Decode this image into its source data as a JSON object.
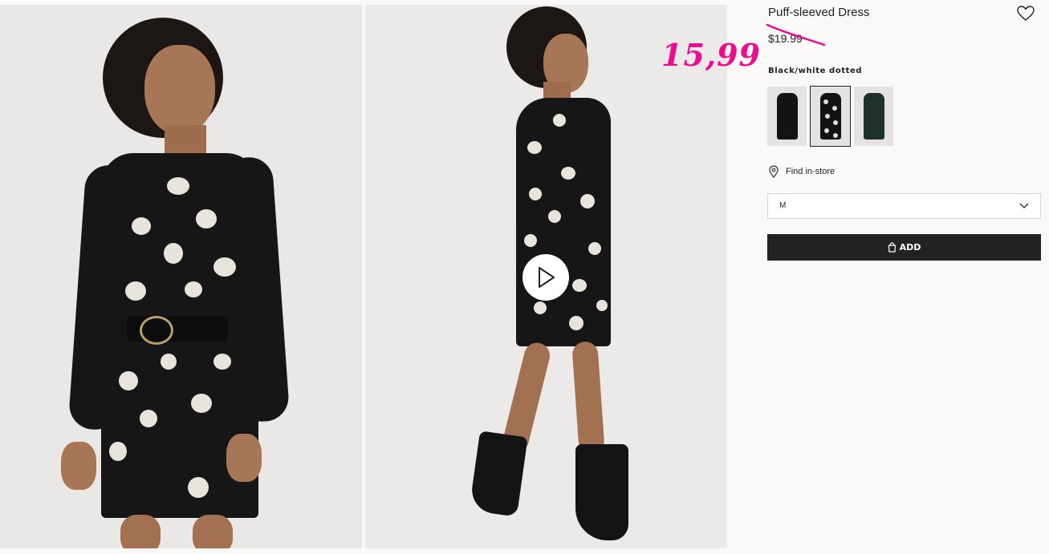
{
  "product": {
    "title": "Puff-sleeved Dress",
    "price_old": "$19.99",
    "price_new": "15,99",
    "color_name": "Black/white dotted",
    "find_in_store": "Find in-store",
    "size_selected": "M",
    "add_label": "ADD"
  },
  "swatches": [
    {
      "color": "black",
      "hex": "#131313"
    },
    {
      "color": "black/white dotted",
      "hex": "#121212",
      "selected": true
    },
    {
      "color": "dark green",
      "hex": "#1e3229"
    }
  ],
  "colors": {
    "accent_pink": "#ec0c8e",
    "button_dark": "#222222",
    "panel_bg": "#faf9f8"
  },
  "icons": {
    "favorite": "heart-outline-icon",
    "store": "location-pin-icon",
    "dropdown": "chevron-down-icon",
    "bag": "shopping-bag-icon",
    "video": "play-icon"
  }
}
